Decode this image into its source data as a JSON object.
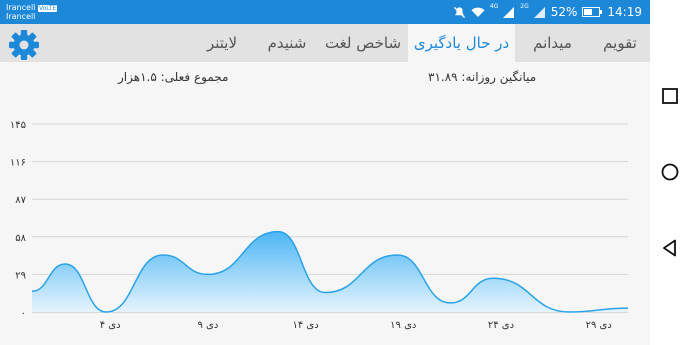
{
  "status_bar": {
    "carrier_line1": "Irancell",
    "carrier_badge": "VoLTE",
    "carrier_line2": "Irancell",
    "network_4g": "4G",
    "network_2g": "2G",
    "battery": "52%",
    "time": "14:19"
  },
  "tabs": [
    {
      "label": "تقویم",
      "active": false
    },
    {
      "label": "میدانم",
      "active": false
    },
    {
      "label": "در حال یادگیری",
      "active": true
    },
    {
      "label": "شاخص لغت",
      "active": false
    },
    {
      "label": "شنیدم",
      "active": false
    },
    {
      "label": "لایتنر",
      "active": false
    }
  ],
  "stats": {
    "daily_average": "میانگین روزانه: ۳۱.۸۹",
    "total_actual": "مجموع فعلی: ۱.۵هزار"
  },
  "colors": {
    "accent": "#1e88d8",
    "line": "#29a3e6",
    "fill_top": "#4db6f5",
    "fill_bottom": "#e6f4fd"
  },
  "chart_data": {
    "type": "area",
    "y_tick_labels": [
      "۰",
      "۲۹",
      "۵۸",
      "۸۷",
      "۱۱۶",
      "۱۴۵"
    ],
    "y_ticks": [
      0,
      29,
      58,
      87,
      116,
      145
    ],
    "ylim": [
      0,
      145
    ],
    "x_tick_labels": [
      "۴ دی",
      "۹ دی",
      "۱۴ دی",
      "۱۹ دی",
      "۲۴ دی",
      "۲۹ دی"
    ],
    "x_ticks": [
      4,
      9,
      14,
      19,
      24,
      29
    ],
    "xlim": [
      0,
      30.5
    ],
    "x": [
      0,
      1.7,
      3.8,
      6.7,
      9,
      12.6,
      15,
      18.7,
      21.4,
      23.6,
      27.5,
      30.5
    ],
    "values": [
      16,
      37,
      0,
      44,
      29,
      62,
      15,
      44,
      7,
      26,
      0,
      3
    ],
    "grid": true
  }
}
